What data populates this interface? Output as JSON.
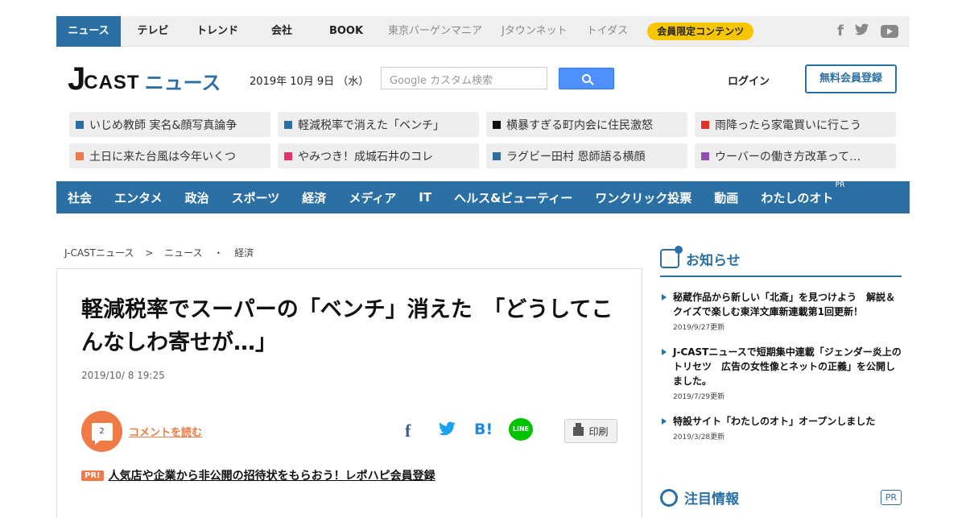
{
  "topnav": {
    "items": [
      "ニュース",
      "テレビ",
      "トレンド",
      "会社",
      "BOOK"
    ],
    "sub_items": [
      "東京バーゲンマニア",
      "Jタウンネット",
      "トイダス"
    ],
    "member_label": "会員限定コンテンツ",
    "social": {
      "facebook": "f",
      "twitter": "🐦"
    }
  },
  "header": {
    "logo_j": "J",
    "logo_cast": "CAST",
    "logo_news": "ニュース",
    "date": "2019年 10月 9日 （水）",
    "search_placeholder": "Google カスタム検索",
    "login_label": "ログイン",
    "register_label": "無料会員登録"
  },
  "trending": [
    {
      "label": "いじめ教師 実名&顔写真論争",
      "color": "#2a70a4"
    },
    {
      "label": "軽減税率で消えた「ベンチ」",
      "color": "#2a70a4"
    },
    {
      "label": "横暴すぎる町内会に住民激怒",
      "color": "#111111"
    },
    {
      "label": "雨降ったら家電買いに行こう",
      "color": "#e2332b"
    },
    {
      "label": "土日に来た台風は今年いくつ",
      "color": "#f07a45"
    },
    {
      "label": "やみつき！成城石井のコレ",
      "color": "#e6336a"
    },
    {
      "label": "ラグビー田村 恩師語る横顔",
      "color": "#2a70a4"
    },
    {
      "label": "ウーバーの働き方改革って…",
      "color": "#8e4fb0"
    }
  ],
  "categories": [
    "社会",
    "エンタメ",
    "政治",
    "スポーツ",
    "経済",
    "メディア",
    "IT",
    "ヘルス&ビューティー",
    "ワンクリック投票",
    "動画",
    "わたしのオト"
  ],
  "category_pr": "PR",
  "breadcrumb": [
    "J-CASTニュース",
    ">",
    "ニュース",
    "・",
    "経済"
  ],
  "article": {
    "title": "軽減税率でスーパーの「ベンチ」消えた　「どうしてこんなしわ寄せが…」",
    "date": "2019/10/ 8 19:25",
    "comment_count": "2",
    "comment_link": "コメントを読む",
    "share_fb": "f",
    "share_hb": "B!",
    "share_line": "LINE",
    "print_label": "印刷",
    "pr_badge": "PR!",
    "pr_text": "人気店や企業から非公開の招待状をもらおう！レポハピ会員登録"
  },
  "sidebar": {
    "notice_title": "お知らせ",
    "notices": [
      {
        "text": "秘蔵作品から新しい「北斎」を見つけよう　解説＆クイズで楽しむ東洋文庫新連載第1回更新！",
        "date": "2019/9/27更新"
      },
      {
        "text": "J-CASTニュースで短期集中連載「ジェンダー炎上のトリセツ　広告の女性像とネットの正義」を公開しました。",
        "date": "2019/7/29更新"
      },
      {
        "text": "特設サイト「わたしのオト」オープンしました",
        "date": "2019/3/28更新"
      }
    ],
    "attention_title": "注目情報",
    "attention_pr": "PR"
  },
  "colors": {
    "accent": "#2a70a4",
    "orange": "#f07a45",
    "member_yellow": "#f6c700"
  }
}
